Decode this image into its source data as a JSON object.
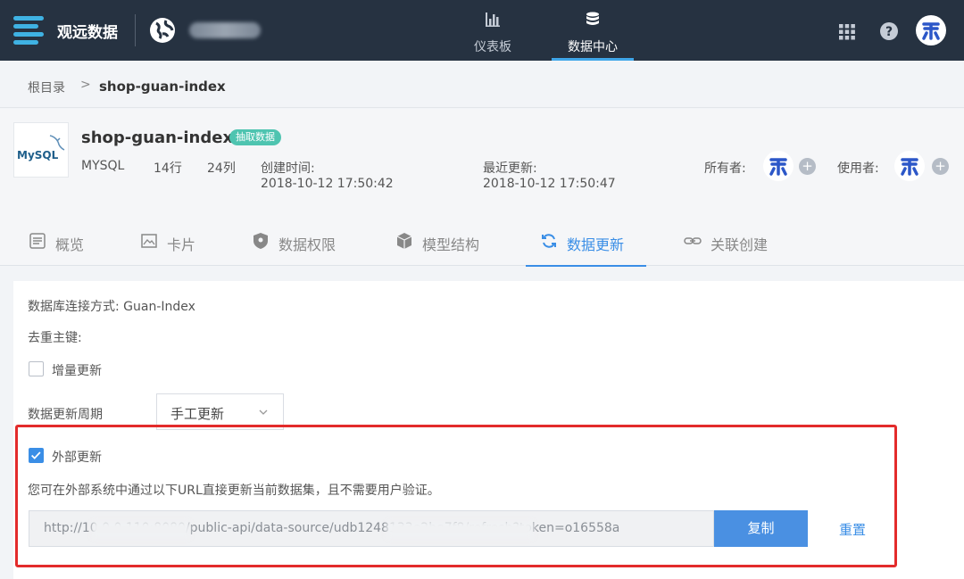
{
  "app": {
    "name": "观远数据",
    "logo_icon": "hamburger-menu-icon",
    "accent": "#3fa6e8"
  },
  "topbar": {
    "nav": [
      {
        "label": "仪表板",
        "icon": "bar-chart-icon",
        "active": false
      },
      {
        "label": "数据中心",
        "icon": "database-icon",
        "active": true
      }
    ],
    "right_icons": [
      "apps-grid-icon",
      "help-icon",
      "user-avatar-icon"
    ]
  },
  "breadcrumb": {
    "root": "根目录",
    "separator": ">",
    "current": "shop-guan-index"
  },
  "dataset": {
    "name": "shop-guan-index",
    "tag": "抽取数据",
    "db_type": "MYSQL",
    "rows": "14行",
    "cols": "24列",
    "created_label": "创建时间:",
    "created_value": "2018-10-12 17:50:42",
    "updated_label": "最近更新:",
    "updated_value": "2018-10-12 17:50:47",
    "owner_label": "所有者:",
    "user_label": "使用者:",
    "logo_text": "MySQL"
  },
  "tabs": [
    {
      "label": "概览",
      "icon": "overview-icon",
      "active": false
    },
    {
      "label": "卡片",
      "icon": "card-image-icon",
      "active": false
    },
    {
      "label": "数据权限",
      "icon": "shield-icon",
      "active": false
    },
    {
      "label": "模型结构",
      "icon": "cube-icon",
      "active": false
    },
    {
      "label": "数据更新",
      "icon": "refresh-icon",
      "active": true
    },
    {
      "label": "关联创建",
      "icon": "link-icon",
      "active": false
    }
  ],
  "content": {
    "connection": "数据库连接方式: Guan-Index",
    "dedup": "去重主键:",
    "incremental_label": "增量更新",
    "incremental_checked": false,
    "cycle_label": "数据更新周期",
    "cycle_value": "手工更新",
    "external_label": "外部更新",
    "external_checked": true,
    "external_desc": "您可在外部系统中通过以下URL直接更新当前数据集，且不需要用户验证。",
    "url": "http://10.0.0.110:8080/public-api/data-source/udb1248133e2be7f8/refresh?token=o16558a",
    "copy_label": "复制",
    "reset_label": "重置",
    "highlight_color": "#e32b2b"
  }
}
